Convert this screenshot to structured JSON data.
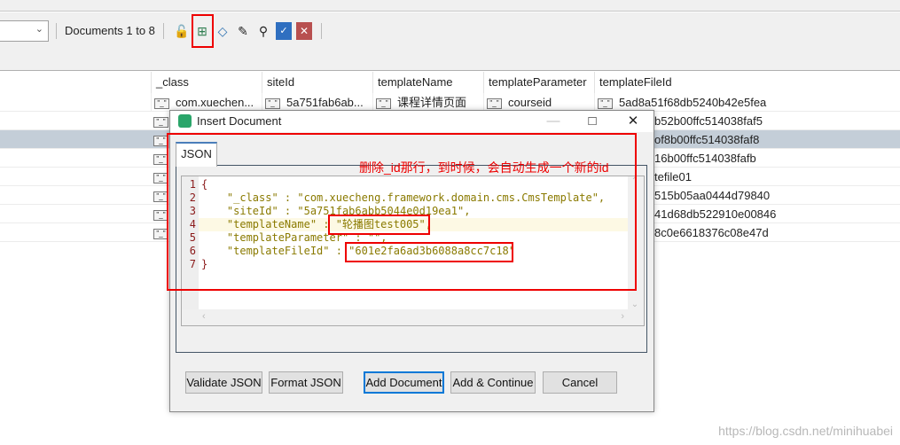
{
  "toolbar": {
    "doc_count": "Documents 1 to 8",
    "icons": [
      "lock-icon",
      "insert-document-icon",
      "clone-document-icon",
      "edit-document-icon",
      "view-document-icon",
      "validate-icon",
      "delete-icon"
    ]
  },
  "grid": {
    "columns": [
      "_class",
      "siteId",
      "templateName",
      "templateParameter",
      "templateFileId"
    ],
    "first_row": [
      "com.xuechen...",
      "5a751fab6ab...",
      "课程详情页面",
      "courseid",
      "5ad8a51f68db5240b42e5fea"
    ],
    "fragments": [
      "b52b00ffc514038faf5",
      "of8b00ffc514038faf8",
      "16b00ffc514038fafb",
      "tefile01",
      "515b05aa0444d79840",
      "41d68db522910e00846",
      "8c0e6618376c08e47d"
    ],
    "selected_row": 3
  },
  "dialog": {
    "title": "Insert Document",
    "tab": "JSON",
    "lines": [
      "{",
      "    \"_class\" : \"com.xuecheng.framework.domain.cms.CmsTemplate\",",
      "    \"siteId\" : \"5a751fab6abb5044e0d19ea1\",",
      "    \"templateName\" : \"轮播图test005\",",
      "    \"templateParameter\" : \"\",",
      "    \"templateFileId\" : \"601e2fa6ad3b6088a8cc7c18\"",
      "}"
    ],
    "line_numbers": [
      "1",
      "2",
      "3",
      "4",
      "5",
      "6",
      "7"
    ],
    "buttons": {
      "validate": "Validate JSON",
      "format": "Format JSON",
      "add": "Add Document",
      "add_continue": "Add & Continue",
      "cancel": "Cancel"
    }
  },
  "annotation": "删除_id那行，到时候，会自动生成一个新的id",
  "watermark": "https://blog.csdn.net/minihuabei",
  "colors": {
    "annotation": "#ee0000",
    "selected_row": "#c4ced8",
    "accent": "#0078d7"
  }
}
